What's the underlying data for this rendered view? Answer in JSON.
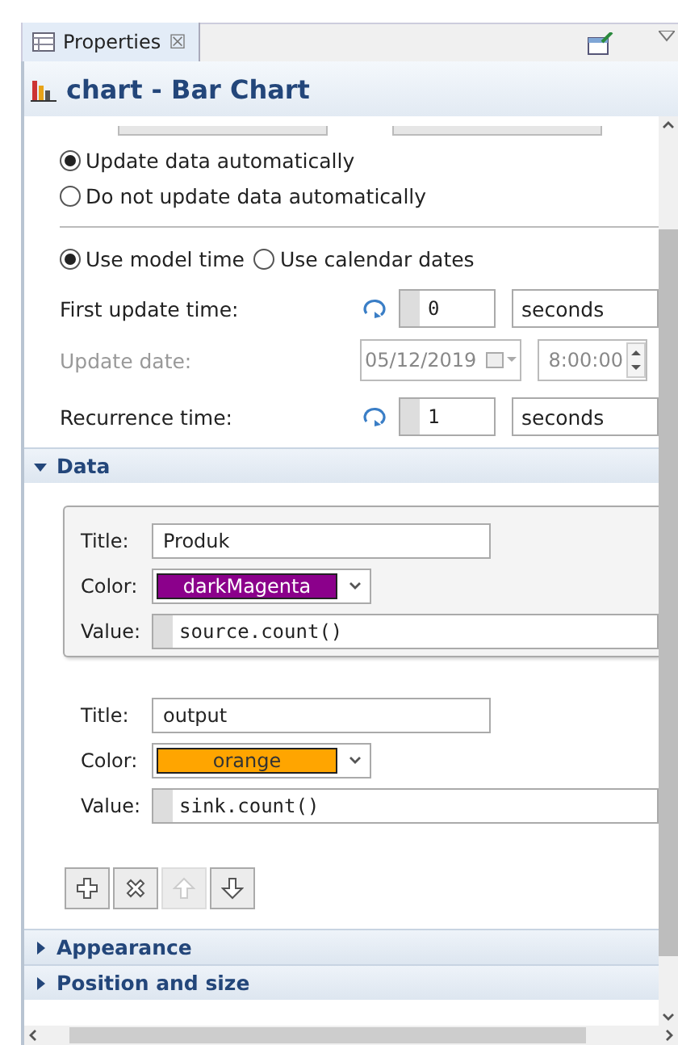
{
  "tab": {
    "label": "Properties",
    "close": "☒"
  },
  "title": "chart - Bar Chart",
  "update_mode": [
    {
      "label": "Update data automatically",
      "selected": true
    },
    {
      "label": "Do not update data automatically",
      "selected": false
    }
  ],
  "time_mode": [
    {
      "label": "Use model time",
      "selected": true
    },
    {
      "label": "Use calendar dates",
      "selected": false
    }
  ],
  "first_update": {
    "label": "First update time:",
    "value": "0",
    "unit": "seconds"
  },
  "update_date": {
    "label": "Update date:",
    "date": "05/12/2019",
    "time": "8:00:00",
    "disabled": true
  },
  "recurrence": {
    "label": "Recurrence time:",
    "value": "1",
    "unit": "seconds"
  },
  "data_section": {
    "label": "Data",
    "expanded": true
  },
  "series": [
    {
      "selected": true,
      "title_label": "Title:",
      "title": "Produk",
      "color_label": "Color:",
      "color_name": "darkMagenta",
      "color": "#8b008b",
      "value_label": "Value:",
      "value": "source.count()"
    },
    {
      "selected": false,
      "title_label": "Title:",
      "title": "output",
      "color_label": "Color:",
      "color_name": "orange",
      "color": "#ffa500",
      "value_label": "Value:",
      "value": "sink.count()"
    }
  ],
  "buttons": [
    {
      "kind": "add",
      "disabled": false
    },
    {
      "kind": "remove",
      "disabled": false
    },
    {
      "kind": "up",
      "disabled": true
    },
    {
      "kind": "down",
      "disabled": false
    }
  ],
  "sections": [
    {
      "label": "Appearance",
      "expanded": false
    },
    {
      "label": "Position and size",
      "expanded": false
    }
  ]
}
